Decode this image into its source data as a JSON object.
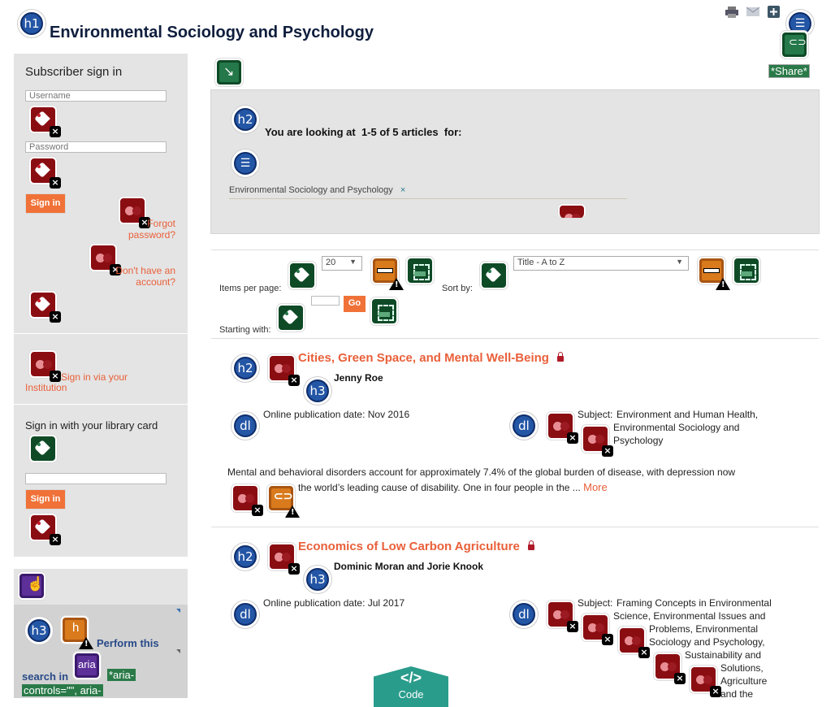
{
  "header": {
    "title": "Environmental Sociology and Psychology",
    "h1_badge": "h1",
    "tools": [
      "print-icon",
      "email-icon",
      "add-icon",
      "list-icon"
    ],
    "share_labels": [
      "*Share*",
      "*Share*"
    ]
  },
  "sidebar": {
    "subscriber": {
      "heading": "Subscriber sign in",
      "username_placeholder": "Username",
      "password_placeholder": "Password",
      "sign_in_label": "Sign in",
      "forgot_link": "Forgot password?",
      "no_account_link": "Don't have an account?"
    },
    "institution": {
      "link": "Sign in via your Institution"
    },
    "library": {
      "heading": "Sign in with your library card",
      "card_value": "",
      "sign_in_label": "Sign in"
    },
    "search_panel": {
      "h3_badge": "h3",
      "text_1": "Perform this",
      "text_2": "search in",
      "aria_badge": "aria",
      "aria_note_1": "*aria-",
      "aria_note_2": "controls=\"\", aria-"
    }
  },
  "results": {
    "h2_badge": "h2",
    "summary": "You are looking at  1-5 of 5 articles  for:",
    "filter_chip": "Environmental Sociology and Psychology",
    "filter_remove": "×"
  },
  "controls": {
    "items_per_page_label": "Items per page:",
    "items_per_page_value": "20",
    "sort_by_label": "Sort by:",
    "sort_by_value": "Title - A to Z",
    "starting_with_label": "Starting with:",
    "starting_with_value": "",
    "go_label": "Go"
  },
  "articles": [
    {
      "h2": "h2",
      "h3": "h3",
      "dl": "dl",
      "title": "Cities, Green Space, and Mental Well-Being",
      "authors": "Jenny Roe",
      "pub_date": "Online publication date: Nov 2016",
      "subject_label": "Subject:",
      "subjects": [
        "Environment and Human Health,",
        "Environmental Sociology and",
        "Psychology"
      ],
      "abstract_1": "Mental and behavioral disorders account for approximately 7.4% of the global burden of disease, with depression now",
      "abstract_2": "the world’s leading cause of disability. One in four people in the ...",
      "more": "More"
    },
    {
      "h2": "h2",
      "h3": "h3",
      "dl": "dl",
      "title": "Economics of Low Carbon Agriculture",
      "authors": "Dominic Moran and Jorie Knook",
      "pub_date": "Online publication date: Jul 2017",
      "subject_label": "Subject:",
      "subjects": [
        "Framing Concepts in Environmental",
        "Science, Environmental Issues and",
        "Problems, Environmental",
        "Sociology and Psychology,",
        "Sustainability and",
        "Solutions,",
        "Agriculture",
        "and the"
      ]
    }
  ],
  "code_badge": "Code",
  "colors": {
    "accent": "#e9603a",
    "button": "#f07238",
    "panel": "#e4e4e4",
    "heading": "#0e2d6b"
  }
}
